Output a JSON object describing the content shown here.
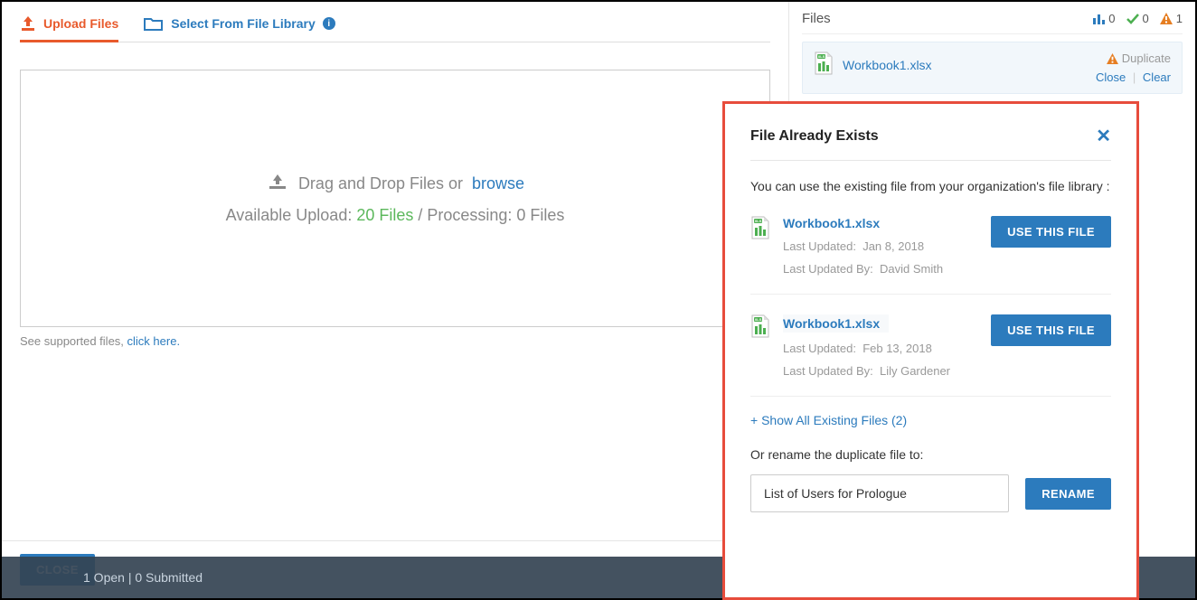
{
  "tabs": {
    "upload": "Upload Files",
    "library": "Select From File Library"
  },
  "dropzone": {
    "text": "Drag and Drop Files or",
    "browse": "browse",
    "available_prefix": "Available Upload: ",
    "available_count": "20 Files",
    "processing": " / Processing: 0 Files"
  },
  "supported": {
    "text": "See supported files, ",
    "link": "click here."
  },
  "close_btn": "CLOSE",
  "files_panel": {
    "title": "Files",
    "stat_poll": "0",
    "stat_ok": "0",
    "stat_warn": "1",
    "file": {
      "name": "Workbook1.xlsx",
      "dup": "Duplicate",
      "close": "Close",
      "clear": "Clear"
    }
  },
  "modal": {
    "title": "File Already Exists",
    "desc": "You can use the existing file from your organization's file library :",
    "files": [
      {
        "name": "Workbook1.xlsx",
        "updated_label": "Last Updated:",
        "updated": "Jan 8, 2018",
        "by_label": "Last Updated By:",
        "by": "David Smith"
      },
      {
        "name": "Workbook1.xlsx",
        "updated_label": "Last Updated:",
        "updated": "Feb 13, 2018",
        "by_label": "Last Updated By:",
        "by": "Lily Gardener"
      }
    ],
    "use_btn": "USE THIS FILE",
    "show_all": "+ Show All Existing Files (2)",
    "rename_label": "Or rename the duplicate file to:",
    "rename_value": "List of Users for Prologue",
    "rename_btn": "RENAME"
  },
  "strip": "1 Open | 0 Submitted"
}
